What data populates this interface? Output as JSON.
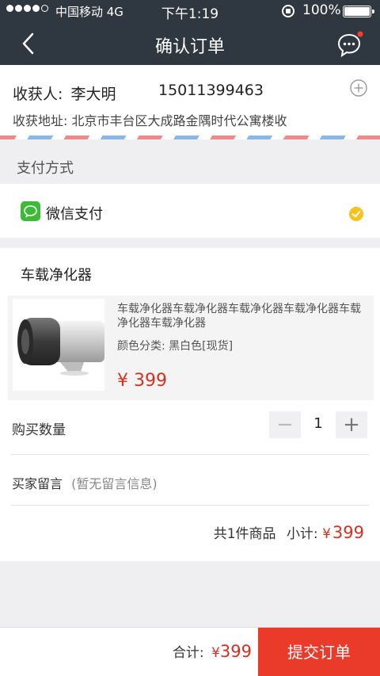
{
  "status_bar": {
    "carrier": "中国移动 4G",
    "time": "下午1:19",
    "battery": "100%"
  },
  "nav": {
    "title": "确认订单",
    "back_icon": "chevron-left-icon",
    "message_icon": "chat-bubble-icon"
  },
  "address": {
    "receiver_label": "收获人:",
    "receiver_name": "李大明",
    "phone": "15011399463",
    "address_label": "收获地址:",
    "address_value": "北京市丰台区大成路金隅时代公寓楼收"
  },
  "payment": {
    "section_title": "支付方式",
    "method_label": "微信支付",
    "selected": true
  },
  "order": {
    "store_name": "车载净化器",
    "product": {
      "name": "车载净化器车载净化器车载净化器车载净化器车载净化器车载净化器",
      "spec": "颜色分类: 黑白色[现货]",
      "price": "¥ 399"
    },
    "quantity_label": "购买数量",
    "quantity_minus": "−",
    "quantity": "1",
    "quantity_plus": "+",
    "memo_label": "买家留言",
    "memo_placeholder": "(暂无留言信息)",
    "summary_count": "共1件商品",
    "subtotal_label": "小计:",
    "currency": "¥",
    "subtotal_value": "399"
  },
  "footer": {
    "total_label": "合计:",
    "currency": "¥",
    "total_value": "399",
    "submit_label": "提交订单"
  },
  "colors": {
    "nav_bg": "#2f3741",
    "accent_red": "#ea3a2a",
    "price_red": "#d92e1f",
    "wechat_green": "#3dbb37",
    "check_yellow": "#f6c21c"
  }
}
